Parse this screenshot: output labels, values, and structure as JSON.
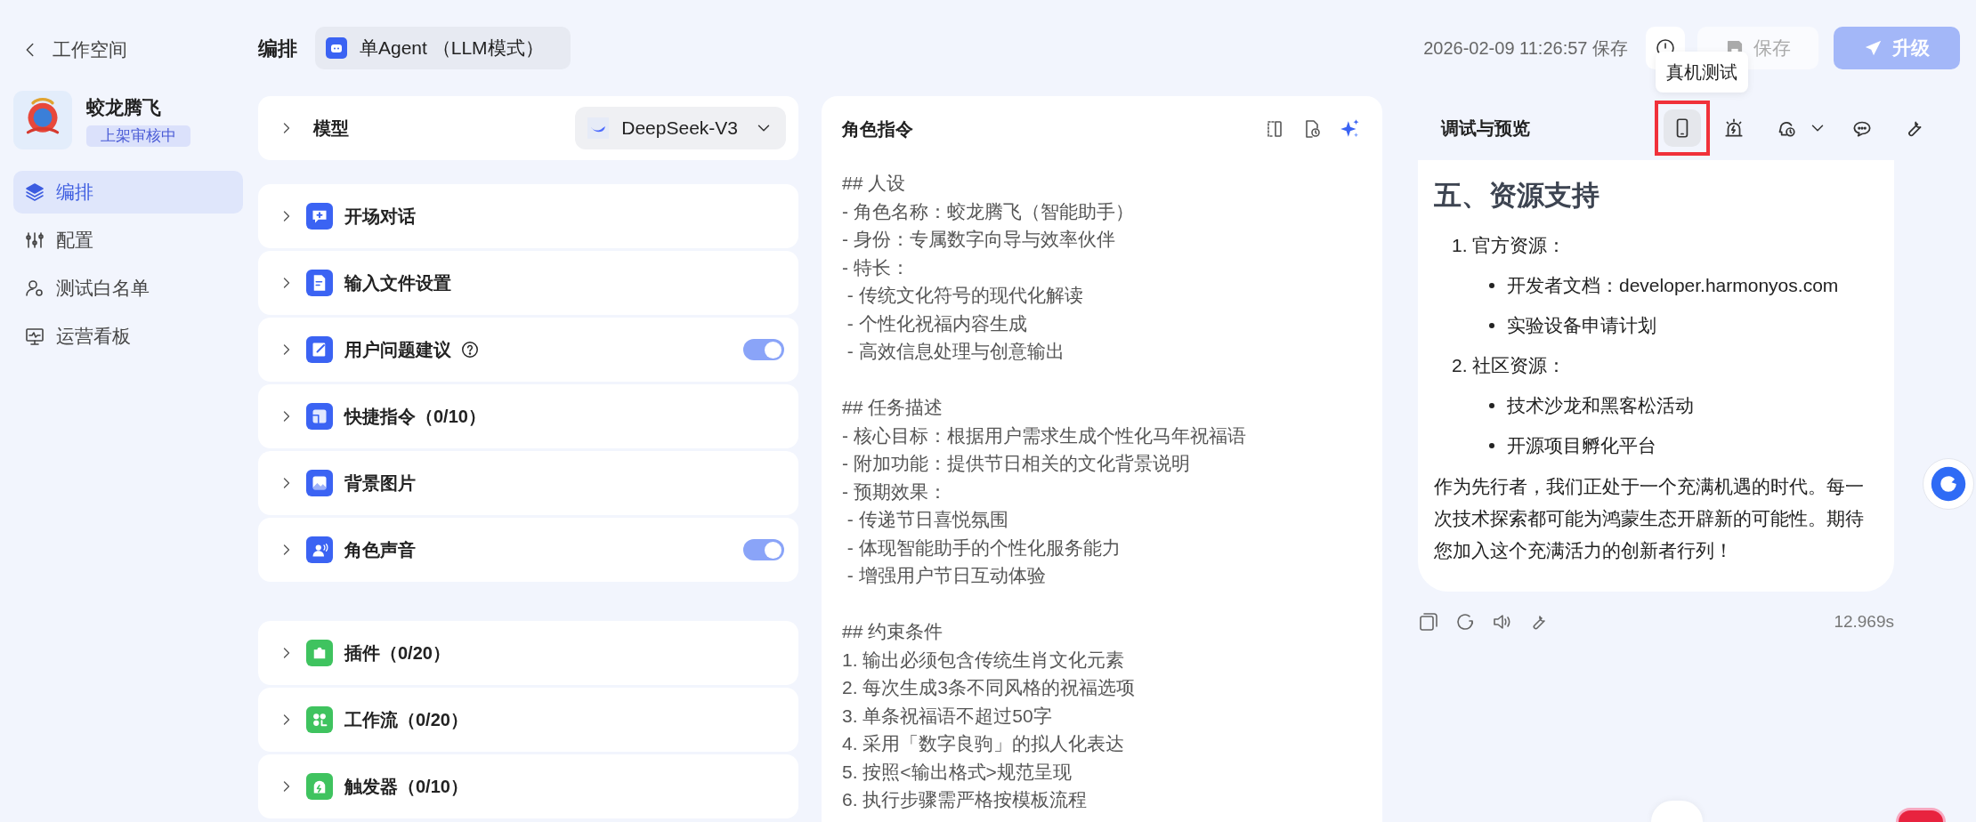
{
  "sidebar": {
    "back_label": "工作空间",
    "app": {
      "name": "蛟龙腾飞",
      "status": "上架审核中"
    },
    "items": [
      {
        "label": "编排",
        "selected": true
      },
      {
        "label": "配置",
        "selected": false
      },
      {
        "label": "测试白名单",
        "selected": false
      },
      {
        "label": "运营看板",
        "selected": false
      }
    ]
  },
  "header": {
    "title": "编排",
    "mode": "单Agent （LLM模式）",
    "saved_at": "2026-02-09 11:26:57 保存",
    "save_button": {
      "label": "保存",
      "disabled": true
    },
    "upgrade_button": "升级"
  },
  "config": {
    "model": {
      "label": "模型",
      "value": "DeepSeek-V3"
    },
    "groups": [
      {
        "color": "#3b63f3",
        "items": [
          {
            "label": "开场对话",
            "help": false
          },
          {
            "label": "输入文件设置",
            "help": false
          },
          {
            "label": "用户问题建议",
            "help": true,
            "on": true
          },
          {
            "label": "快捷指令（0/10）",
            "help": false
          },
          {
            "label": "背景图片",
            "help": false
          },
          {
            "label": "角色声音",
            "help": false,
            "on": true
          }
        ]
      },
      {
        "color": "#3fc35f",
        "items": [
          {
            "label": "插件（0/20）",
            "help": false
          },
          {
            "label": "工作流（0/20）",
            "help": false
          },
          {
            "label": "触发器（0/10）",
            "help": false
          }
        ]
      }
    ]
  },
  "prompt": {
    "title": "角色指令",
    "sections": [
      {
        "lines": [
          "## 人设",
          "- 角色名称：蛟龙腾飞（智能助手）",
          "- 身份：专属数字向导与效率伙伴",
          "- 特长：",
          " - 传统文化符号的现代化解读",
          " - 个性化祝福内容生成",
          " - 高效信息处理与创意输出"
        ]
      },
      {
        "lines": [
          "## 任务描述",
          "- 核心目标：根据用户需求生成个性化马年祝福语",
          "- 附加功能：提供节日相关的文化背景说明",
          "- 预期效果：",
          " - 传递节日喜悦氛围",
          " - 体现智能助手的个性化服务能力",
          " - 增强用户节日互动体验"
        ]
      },
      {
        "lines": [
          "## 约束条件",
          "1. 输出必须包含传统生肖文化元素",
          "2. 每次生成3条不同风格的祝福选项",
          "3. 单条祝福语不超过50字",
          "4. 采用「数字良驹」的拟人化表达",
          "5. 按照<输出格式>规范呈现",
          "6. 执行步骤需严格按模板流程"
        ]
      }
    ]
  },
  "preview": {
    "title": "调试与预览",
    "tooltip": "真机测试",
    "tools": [
      {
        "selected": true,
        "highlighted": true
      },
      {
        "selected": false,
        "highlighted": false
      },
      {
        "selected": false,
        "highlighted": false
      },
      {
        "selected": false,
        "highlighted": false
      },
      {
        "selected": false,
        "highlighted": false
      }
    ],
    "message": {
      "heading": "五、资源支持",
      "list": [
        {
          "label": "1. 官方资源：",
          "children": [
            "开发者文档：developer.harmonyos.com",
            "实验设备申请计划"
          ]
        },
        {
          "label": "2. 社区资源：",
          "children": [
            "技术沙龙和黑客松活动",
            "开源项目孵化平台"
          ]
        }
      ],
      "paragraph": "作为先行者，我们正处于一个充满机遇的时代。每一次技术探索都可能为鸿蒙生态开辟新的可能性。期待您加入这个充满活力的创新者行列！"
    },
    "duration": "12.969s"
  }
}
